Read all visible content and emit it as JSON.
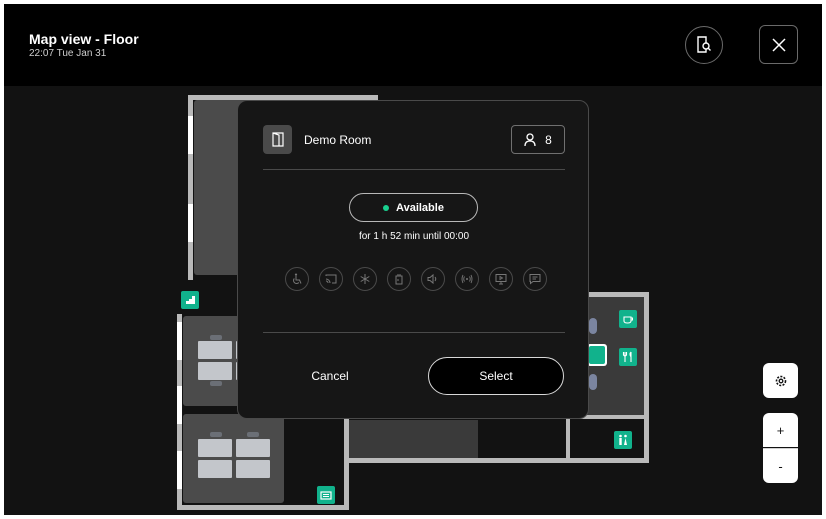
{
  "header": {
    "title": "Map view - Floor",
    "datetime": "22:07 Tue Jan 31"
  },
  "icons": {
    "find": "find-room-icon",
    "close": "close-icon",
    "settings": "gear-icon",
    "room": "door-icon",
    "capacity": "person-icon"
  },
  "map": {
    "zoom_in_label": "+",
    "zoom_out_label": "-"
  },
  "room_dialog": {
    "room_name": "Demo Room",
    "capacity": "8",
    "status": "Available",
    "status_color": "#19d08f",
    "status_detail": "for 1 h 52 min until 00:00",
    "amenities": [
      "accessible-icon",
      "cast-icon",
      "snowflake-icon",
      "power-icon",
      "speaker-icon",
      "wireless-icon",
      "presentation-icon",
      "chat-icon"
    ],
    "cancel_label": "Cancel",
    "select_label": "Select"
  },
  "colors": {
    "background": "#121212",
    "header": "#000000",
    "accent": "#11b28c",
    "room": "#4b4b4b"
  }
}
